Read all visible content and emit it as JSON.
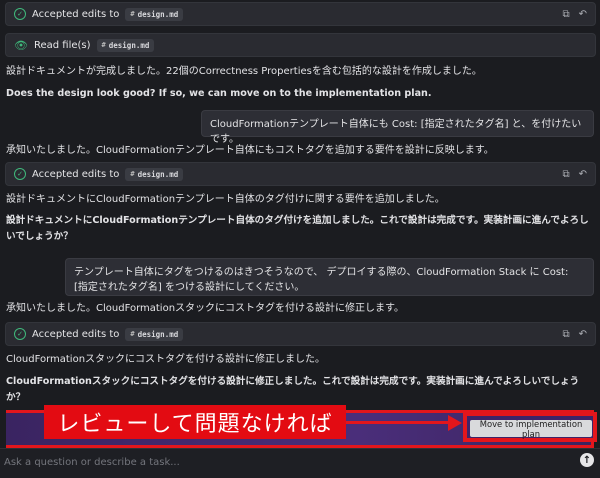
{
  "cards": {
    "accepted_1": {
      "label": "Accepted edits to",
      "file": "design.md"
    },
    "read_files": {
      "label": "Read file(s)",
      "file": "design.md"
    },
    "accepted_2": {
      "label": "Accepted edits to",
      "file": "design.md"
    },
    "accepted_3": {
      "label": "Accepted edits to",
      "file": "design.md"
    }
  },
  "icons": {
    "check": "check-circle-icon",
    "eye": "eye-icon",
    "file": "file-icon",
    "compare": "compare-icon",
    "revert": "undo-icon",
    "send": "arrow-up-icon"
  },
  "glyphs": {
    "check": "✓",
    "eye": "👁",
    "file": "#",
    "compare": "⧉",
    "revert": "↶",
    "send": "↑"
  },
  "messages": {
    "m1": "設計ドキュメントが完成しました。22個のCorrectness Propertiesを含む包括的な設計を作成しました。",
    "m2": "Does the design look good? If so, we can move on to the implementation plan.",
    "u1": "CloudFormationテンプレート自体にも Cost: [指定されたタグ名] と、を付けたいです。",
    "m3": "承知いたしました。CloudFormationテンプレート自体にもコストタグを追加する要件を設計に反映します。",
    "m4": "設計ドキュメントにCloudFormationテンプレート自体のタグ付けに関する要件を追加しました。",
    "m5": "設計ドキュメントにCloudFormationテンプレート自体のタグ付けを追加しました。これで設計は完成です。実装計画に進んでよろしいでしょうか？",
    "u2": "テンプレート自体にタグをつけるのはきつそうなので、 デプロイする際の、CloudFormation Stack に Cost: [指定されたタグ名] をつける設計にしてください。",
    "m6": "承知いたしました。CloudFormationスタックにコストタグを付ける設計に修正します。",
    "m7": "CloudFormationスタックにコストタグを付ける設計に修正しました。",
    "m8": "CloudFormationスタックにコストタグを付ける設計に修正しました。これで設計は完成です。実装計画に進んでよろしいでしょうか？"
  },
  "annotation": {
    "text": "レビューして問題なければ"
  },
  "action": {
    "move_label": "Move to implementation plan"
  },
  "input": {
    "placeholder": "Ask a question or describe a task..."
  },
  "colors": {
    "background": "#1b1c20",
    "card": "#2a2b31",
    "success": "#3fb97b",
    "annotation_red": "#e30b12",
    "panel_purple": "#4a2e7a"
  }
}
